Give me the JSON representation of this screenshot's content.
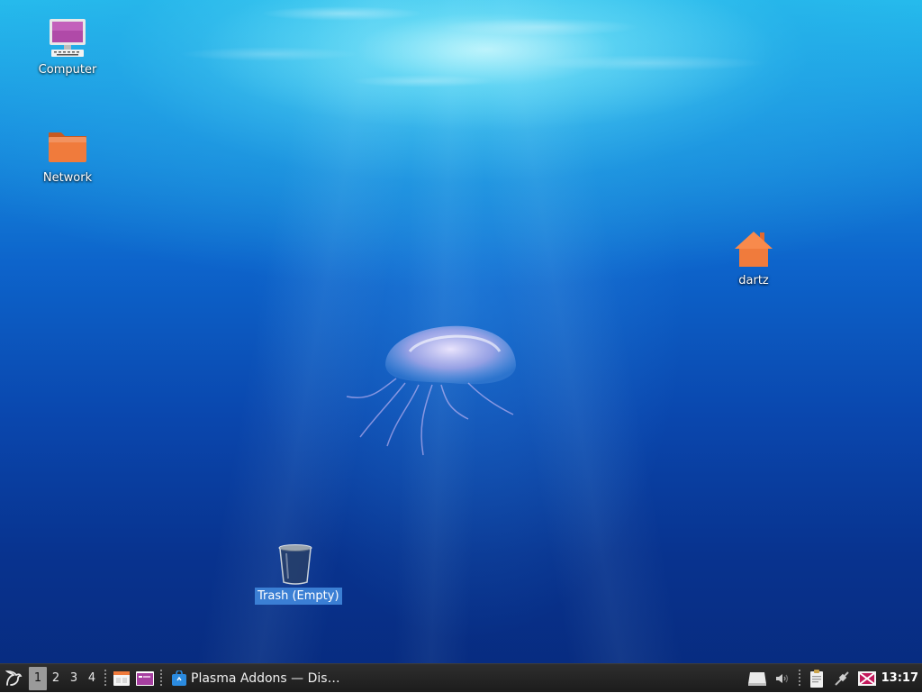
{
  "desktop": {
    "icons": [
      {
        "label": "Computer",
        "icon": "computer-icon"
      },
      {
        "label": "Network",
        "icon": "folder-icon"
      },
      {
        "label": "dartz",
        "icon": "home-icon"
      },
      {
        "label": "Trash (Empty)",
        "icon": "trash-icon",
        "selected": true
      }
    ]
  },
  "taskbar": {
    "menu_icon": "lxqt-menu-icon",
    "workspaces": [
      "1",
      "2",
      "3",
      "4"
    ],
    "active_workspace": "1",
    "quicklaunch": [
      "file-manager-icon",
      "terminal-icon"
    ],
    "tasks": [
      {
        "label": "Plasma Addons — Dis…",
        "icon": "store-bag-icon"
      }
    ],
    "tray": [
      "removable-drive-icon",
      "volume-icon",
      "clipboard-icon",
      "network-cable-icon",
      "screenshot-icon"
    ],
    "clock": "13:17"
  },
  "colors": {
    "selection": "#3b7fd4",
    "taskbar_bg": "#1c1c1c",
    "folder_orange": "#f07b3c"
  }
}
